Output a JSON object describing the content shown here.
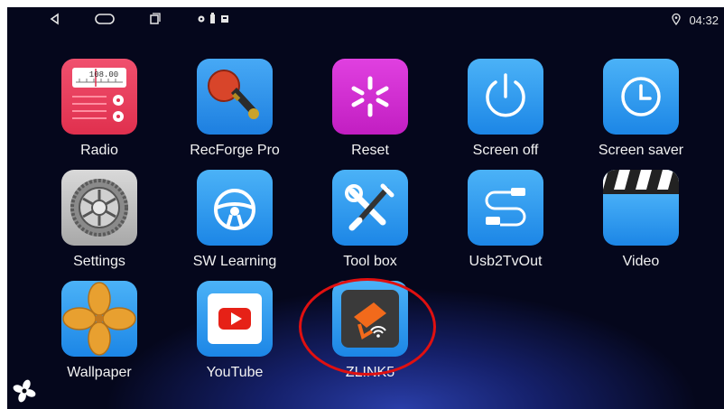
{
  "status_bar": {
    "time": "04:32",
    "icons": [
      "back-icon",
      "home-icon",
      "recents-icon",
      "notification-icons",
      "location-icon"
    ]
  },
  "apps": [
    {
      "label": "Radio",
      "icon": "radio-icon"
    },
    {
      "label": "RecForge Pro",
      "icon": "microphone-icon"
    },
    {
      "label": "Reset",
      "icon": "reset-icon"
    },
    {
      "label": "Screen off",
      "icon": "power-icon"
    },
    {
      "label": "Screen saver",
      "icon": "clock-icon"
    },
    {
      "label": "Settings",
      "icon": "gear-icon"
    },
    {
      "label": "SW Learning",
      "icon": "steering-wheel-icon"
    },
    {
      "label": "Tool box",
      "icon": "tools-icon"
    },
    {
      "label": "Usb2TvOut",
      "icon": "usb-cable-icon"
    },
    {
      "label": "Video",
      "icon": "clapperboard-icon"
    },
    {
      "label": "Wallpaper",
      "icon": "wallpaper-icon"
    },
    {
      "label": "YouTube",
      "icon": "youtube-icon"
    },
    {
      "label": "ZLINK5",
      "icon": "zlink-icon"
    }
  ],
  "radio_frequency": "108.00",
  "highlight_color": "#e01010"
}
